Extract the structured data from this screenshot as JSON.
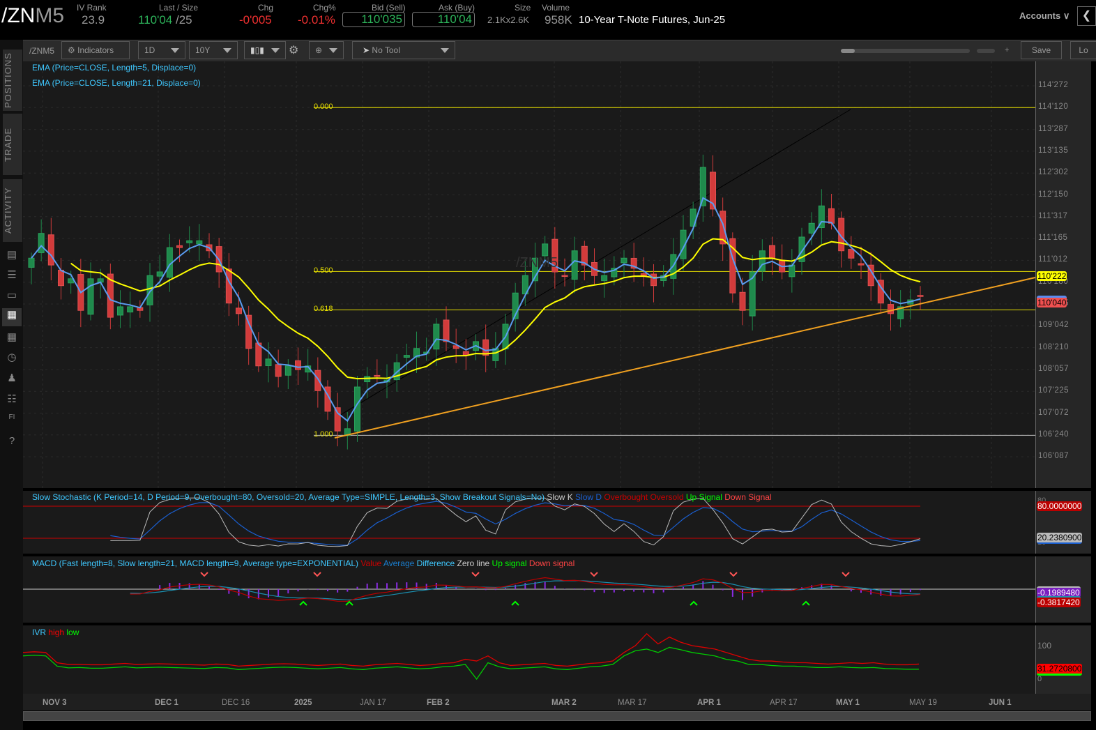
{
  "header": {
    "symbol_main": "/ZN",
    "symbol_suffix": "M5",
    "iv_rank_label": "IV Rank",
    "iv_rank": "23.9",
    "last_label": "Last / Size",
    "last": "110'04",
    "last_size": " /25",
    "chg_label": "Chg",
    "chg": "-0'005",
    "chgpct_label": "Chg%",
    "chgpct": "-0.01%",
    "bid_label": "Bid (Sell)",
    "bid": "110'035",
    "ask_label": "Ask (Buy)",
    "ask": "110'04",
    "size_label": "Size",
    "size": "2.1Kx2.6K",
    "volume_label": "Volume",
    "volume": "958K",
    "description": "10-Year T-Note Futures, Jun-25",
    "accounts": "Accounts"
  },
  "toolbar": {
    "symbol": "/ZNM5",
    "indicators": "Indicators",
    "aggregation": "1D",
    "timeframe": "10Y",
    "tool": "No Tool",
    "save": "Save",
    "load": "Lo",
    "zoom_plus": "+"
  },
  "sidebar": {
    "tabs": [
      "POSITIONS",
      "TRADE",
      "ACTIVITY"
    ]
  },
  "studies": {
    "ema5": "EMA (Price=CLOSE, Length=5, Displace=0)",
    "ema21": "EMA (Price=CLOSE, Length=21, Displace=0)",
    "watermark": "/ZNM5"
  },
  "fib": {
    "l0": "0.000",
    "l50": "0.500",
    "l618": "0.618",
    "l100": "1.000"
  },
  "price_axis": [
    "114'272",
    "114'120",
    "113'287",
    "113'135",
    "112'302",
    "112'150",
    "111'317",
    "111'165",
    "111'012",
    "110'180",
    "109'195",
    "109'042",
    "108'210",
    "108'057",
    "107'225",
    "107'072",
    "106'240",
    "106'087"
  ],
  "price_tags": {
    "ema21": "110'222",
    "last": "110'040"
  },
  "stoch": {
    "title": "Slow Stochastic (K Period=14, D Period=9, Overbought=80, Oversold=20, Average Type=SIMPLE, Length=3, Show Breakout Signals=No)",
    "k": "Slow K",
    "d": "Slow D",
    "ob": "Overbought",
    "os": "Oversold",
    "up": "Up Signal",
    "down": "Down Signal",
    "tag_ob": "80.0000000",
    "tag_k": "20.2380900",
    "axis_top": "80",
    "axis_bot": "10"
  },
  "macd": {
    "title": "MACD (Fast length=8, Slow length=21, MACD length=9, Average type=EXPONENTIAL)",
    "value": "Value",
    "avg": "Average",
    "diff": "Difference",
    "zero": "Zero line",
    "up": "Up signal",
    "down": "Down signal",
    "tag_avg": "-0.1989480",
    "tag_val": "-0.3817420"
  },
  "ivr": {
    "title": "IVR",
    "high": "high",
    "low": "low",
    "axis_100": "100",
    "axis_0": "0",
    "tag": "31.2720800"
  },
  "x_axis": [
    "NOV 3",
    "DEC 1",
    "DEC 16",
    "2025",
    "JAN 17",
    "FEB 2",
    "MAR 2",
    "MAR 17",
    "APR 1",
    "APR 17",
    "MAY 1",
    "MAY 19",
    "JUN 1"
  ],
  "chart_data": {
    "type": "candlestick",
    "price_range": [
      106.273,
      114.85
    ],
    "closes": [
      111.09,
      111.63,
      110.94,
      110.49,
      110.64,
      109.95,
      110.64,
      110.64,
      109.8,
      110.03,
      110.03,
      109.95,
      110.71,
      110.79,
      111.32,
      111.32,
      111.47,
      111.47,
      111.25,
      110.79,
      110.11,
      109.88,
      109.12,
      108.74,
      108.89,
      108.51,
      108.74,
      108.66,
      108.74,
      108.2,
      107.75,
      107.32,
      107.37,
      108.28,
      108.51,
      108.51,
      108.43,
      108.81,
      108.97,
      109.12,
      109.04,
      109.65,
      109.27,
      109.12,
      108.97,
      109.27,
      108.97,
      109.12,
      109.65,
      110.33,
      110.71,
      111.09,
      111.4,
      110.79,
      110.71,
      111.25,
      110.94,
      110.71,
      110.71,
      110.87,
      111.09,
      110.87,
      110.71,
      110.49,
      110.71,
      111.17,
      111.7,
      112.16,
      113.07,
      112.16,
      111.4,
      110.33,
      109.95,
      110.79,
      111.25,
      111.09,
      110.79,
      110.94,
      111.55,
      111.85,
      112.23,
      111.85,
      111.25,
      111.09,
      110.94,
      110.49,
      110.11,
      109.88,
      110.03,
      110.18,
      110.26
    ],
    "fib_levels": {
      "0.000": 114.375,
      "0.500": 110.8,
      "0.618": 109.96,
      "1.000": 107.225
    },
    "ivr_high": [
      80,
      82,
      80,
      50,
      45,
      45,
      44,
      44,
      46,
      48,
      45,
      46,
      47,
      46,
      45,
      44,
      43,
      46,
      45,
      40,
      42,
      44,
      46,
      47,
      46,
      44,
      42,
      44,
      46,
      42,
      40,
      44,
      46,
      48,
      45,
      42,
      44,
      48,
      50,
      60,
      55,
      70,
      50,
      42,
      44,
      46,
      48,
      42,
      40,
      44,
      48,
      50,
      55,
      80,
      100,
      135,
      105,
      125,
      110,
      100,
      95,
      90,
      80,
      70,
      60,
      55,
      55,
      52,
      50,
      50,
      48,
      46,
      48,
      50,
      48,
      50,
      46,
      44,
      44,
      46
    ],
    "ivr_low": [
      70,
      72,
      70,
      40,
      35,
      36,
      34,
      34,
      36,
      38,
      35,
      36,
      37,
      36,
      35,
      34,
      33,
      36,
      35,
      30,
      32,
      34,
      36,
      37,
      36,
      34,
      32,
      34,
      36,
      32,
      30,
      34,
      36,
      38,
      35,
      32,
      34,
      38,
      40,
      45,
      2,
      50,
      38,
      32,
      34,
      36,
      38,
      32,
      30,
      34,
      38,
      40,
      45,
      70,
      85,
      90,
      80,
      95,
      88,
      80,
      75,
      70,
      60,
      55,
      45,
      45,
      42,
      40,
      40,
      38,
      36,
      36,
      38,
      36,
      35,
      36,
      33,
      32,
      31,
      31
    ]
  }
}
